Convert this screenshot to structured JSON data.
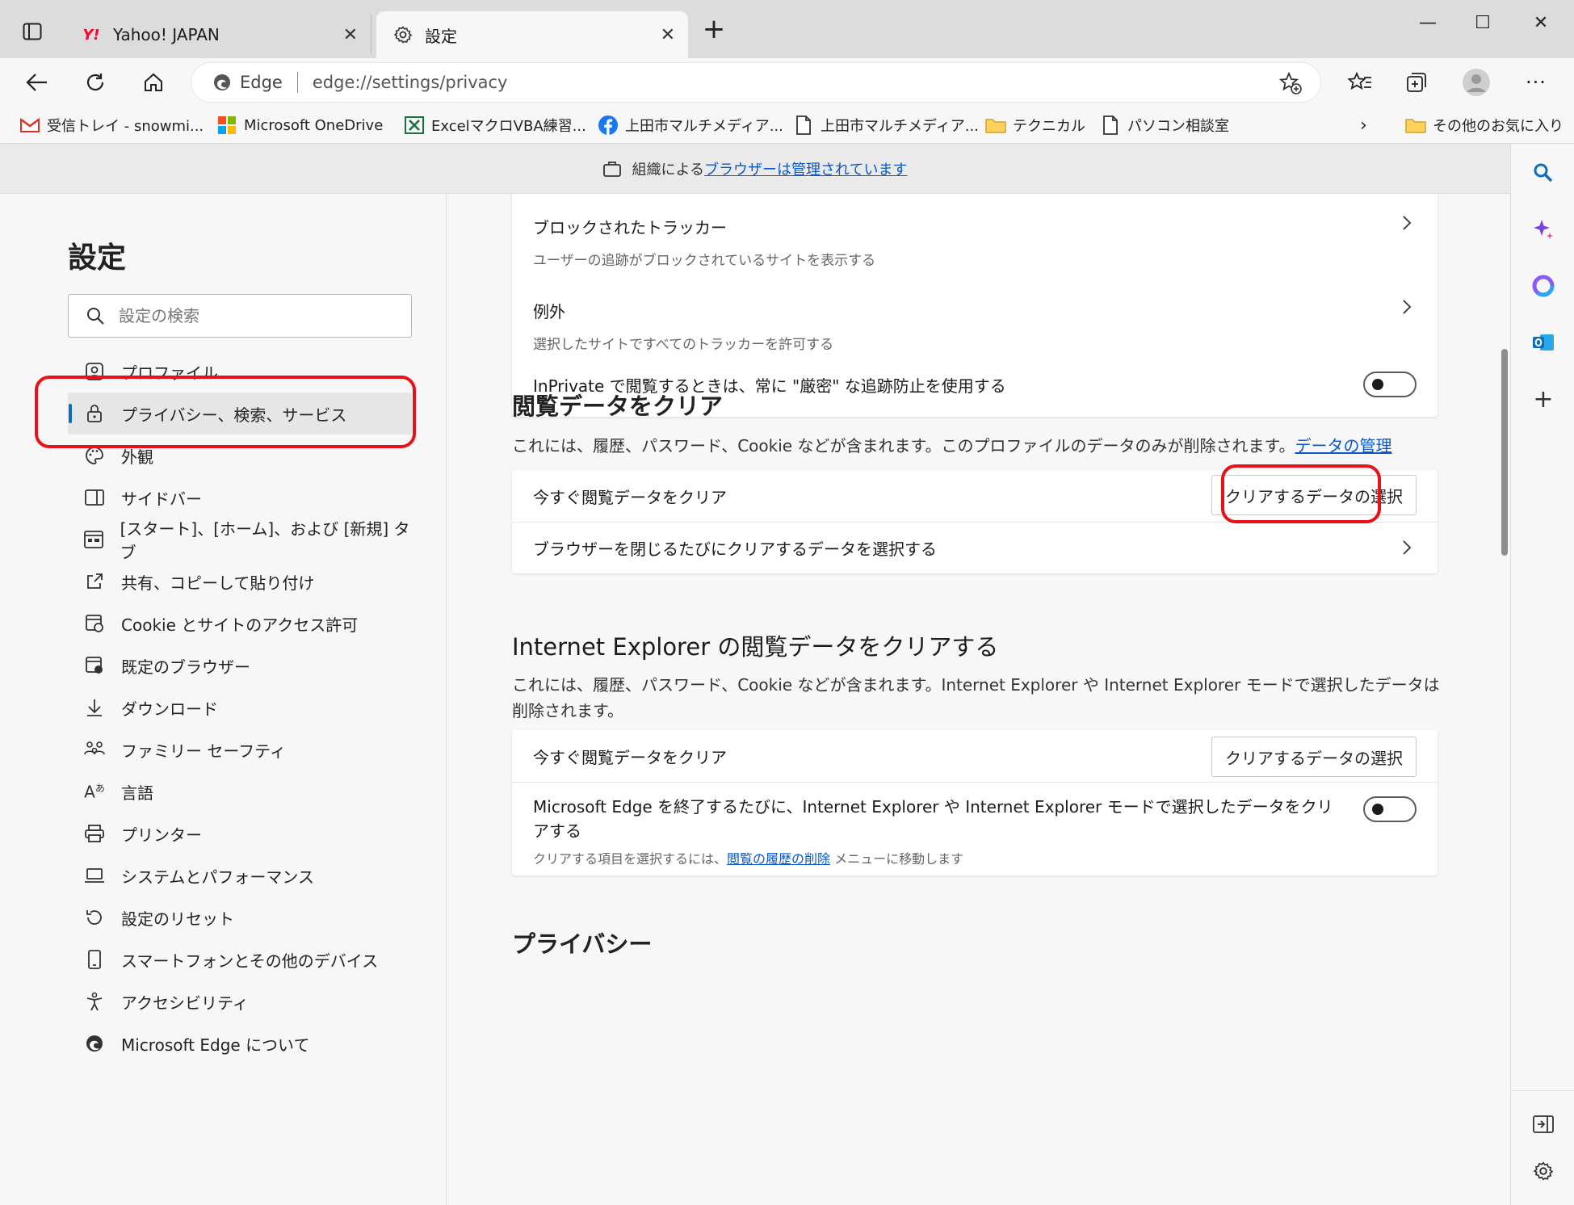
{
  "tabs": [
    {
      "label": "Yahoo! JAPAN",
      "icon": "yahoo-icon",
      "active": false
    },
    {
      "label": "設定",
      "icon": "gear-icon",
      "active": true
    }
  ],
  "window_controls": {
    "minimize": "—",
    "maximize": "☐",
    "close": "✕"
  },
  "address": {
    "brand": "Edge",
    "url": "edge://settings/privacy"
  },
  "bookmarks": [
    {
      "label": "受信トレイ - snowmi...",
      "icon": "gmail-icon"
    },
    {
      "label": "Microsoft OneDrive",
      "icon": "microsoft-icon"
    },
    {
      "label": "ExcelマクロVBA練習...",
      "icon": "excel-icon"
    },
    {
      "label": "上田市マルチメディア...",
      "icon": "facebook-icon"
    },
    {
      "label": "上田市マルチメディア...",
      "icon": "page-icon"
    },
    {
      "label": "テクニカル",
      "icon": "folder-icon"
    },
    {
      "label": "パソコン相談室",
      "icon": "page-icon"
    },
    {
      "label": "その他のお気に入り",
      "icon": "folder-icon"
    }
  ],
  "managed_banner": {
    "prefix": "組織による",
    "link": "ブラウザーは管理されています"
  },
  "settings": {
    "title": "設定",
    "search_placeholder": "設定の検索",
    "nav": [
      {
        "label": "プロファイル",
        "icon": "profile-icon"
      },
      {
        "label": "プライバシー、検索、サービス",
        "icon": "lock-icon",
        "active": true
      },
      {
        "label": "外観",
        "icon": "palette-icon"
      },
      {
        "label": "サイドバー",
        "icon": "sidebar-icon"
      },
      {
        "label": "[スタート]、[ホーム]、および [新規] タブ",
        "icon": "home-tab-icon"
      },
      {
        "label": "共有、コピーして貼り付け",
        "icon": "share-icon"
      },
      {
        "label": "Cookie とサイトのアクセス許可",
        "icon": "cookie-icon"
      },
      {
        "label": "既定のブラウザー",
        "icon": "browser-icon"
      },
      {
        "label": "ダウンロード",
        "icon": "download-icon"
      },
      {
        "label": "ファミリー セーフティ",
        "icon": "family-icon"
      },
      {
        "label": "言語",
        "icon": "language-icon"
      },
      {
        "label": "プリンター",
        "icon": "printer-icon"
      },
      {
        "label": "システムとパフォーマンス",
        "icon": "laptop-icon"
      },
      {
        "label": "設定のリセット",
        "icon": "reset-icon"
      },
      {
        "label": "スマートフォンとその他のデバイス",
        "icon": "phone-icon"
      },
      {
        "label": "アクセシビリティ",
        "icon": "accessibility-icon"
      },
      {
        "label": "Microsoft Edge について",
        "icon": "edge-icon"
      }
    ]
  },
  "tracker_card": {
    "blocked_title": "ブロックされたトラッカー",
    "blocked_sub": "ユーザーの追跡がブロックされているサイトを表示する",
    "exceptions_title": "例外",
    "exceptions_sub": "選択したサイトですべてのトラッカーを許可する",
    "inprivate_label": "InPrivate で閲覧するときは、常に \"厳密\" な追跡防止を使用する"
  },
  "clear_data": {
    "heading": "閲覧データをクリア",
    "desc": "これには、履歴、パスワード、Cookie などが含まれます。このプロファイルのデータのみが削除されます。",
    "desc_link": "データの管理",
    "now_label": "今すぐ閲覧データをクリア",
    "choose_button": "クリアするデータの選択",
    "on_close_label": "ブラウザーを閉じるたびにクリアするデータを選択する"
  },
  "ie_clear": {
    "heading": "Internet Explorer の閲覧データをクリアする",
    "desc": "これには、履歴、パスワード、Cookie などが含まれます。Internet Explorer や Internet Explorer モードで選択したデータは削除されます。",
    "now_label": "今すぐ閲覧データをクリア",
    "choose_button": "クリアするデータの選択",
    "on_exit_label": "Microsoft Edge を終了するたびに、Internet Explorer や Internet Explorer モードで選択したデータをクリアする",
    "hint_prefix": "クリアする項目を選択するには、",
    "hint_link": "閲覧の履歴の削除",
    "hint_suffix": " メニューに移動します"
  },
  "privacy_heading": "プライバシー",
  "colors": {
    "accent": "#0f6cbd",
    "link": "#0a58c9",
    "highlight": "#e8111a"
  }
}
